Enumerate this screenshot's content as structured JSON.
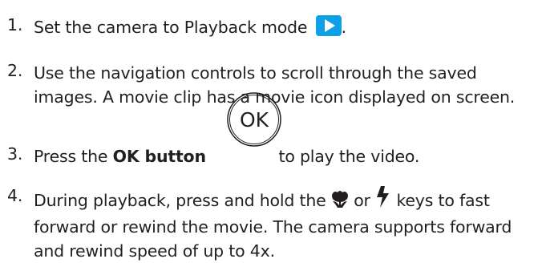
{
  "steps": [
    {
      "number": "1.",
      "text_before": "Set the camera to Playback mode",
      "icon": "playback-icon",
      "text_after": "."
    },
    {
      "number": "2.",
      "line1": "Use the navigation controls to scroll through the saved",
      "line2": "images. A movie clip has a movie icon displayed on screen."
    },
    {
      "number": "3.",
      "text_before": "Press the",
      "bold": "OK button",
      "button_label": "OK",
      "text_after": "to play the video."
    },
    {
      "number": "4.",
      "line1_before": "During playback, press and hold the",
      "macro_icon": "macro-flower-icon",
      "or": "or",
      "flash_icon": "flash-icon",
      "line1_after": "keys to fast",
      "line2": "forward or rewind the movie. The camera supports forward",
      "line3": "and rewind speed of up to 4x."
    }
  ],
  "colors": {
    "text": "#231f20",
    "playback_icon": "#0da0e6"
  }
}
